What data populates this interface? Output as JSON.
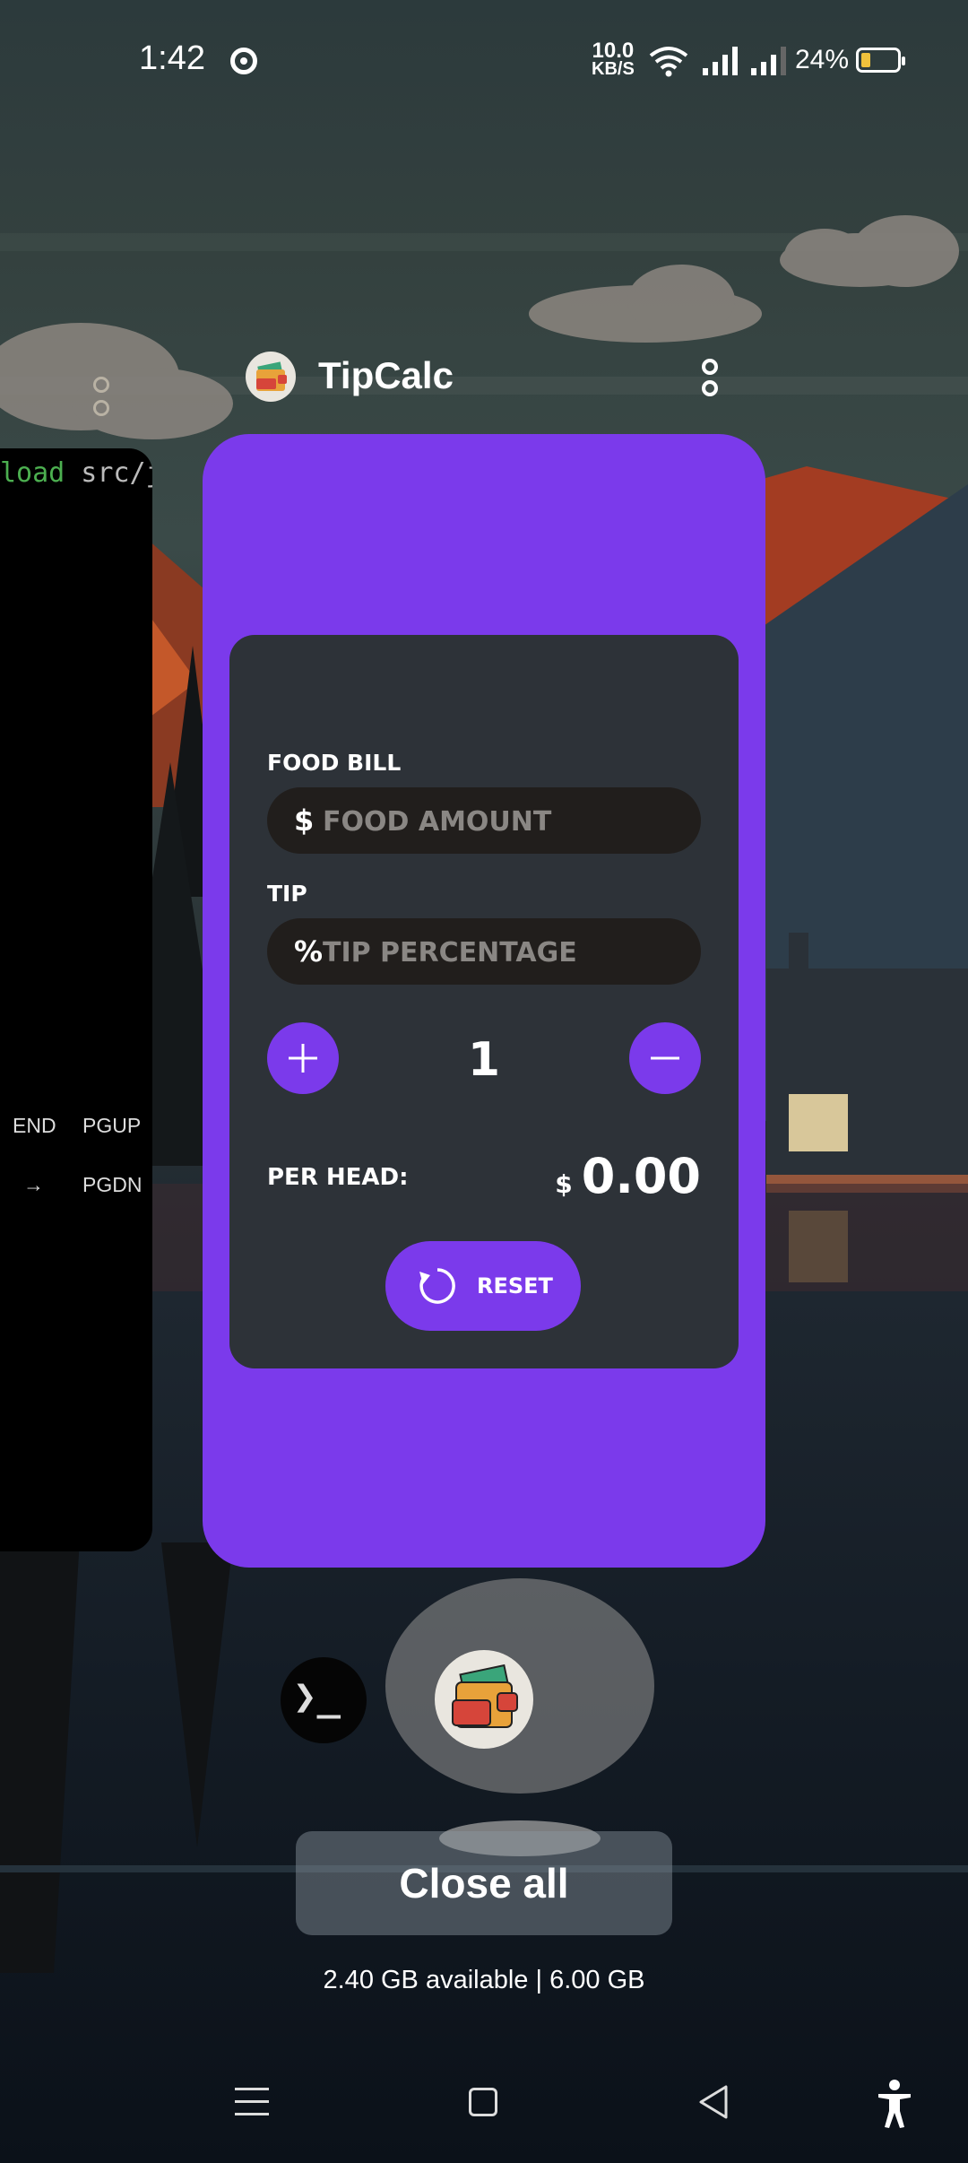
{
  "status_bar": {
    "time": "1:42",
    "net_speed_value": "10.0",
    "net_speed_unit": "KB/S",
    "battery_percent": "24%"
  },
  "background_app": {
    "code_text_green": "load",
    "code_text": " src/j",
    "keys": [
      "END",
      "PGUP",
      "→",
      "PGDN"
    ]
  },
  "app_header": {
    "title": "TipCalc"
  },
  "tipcalc": {
    "food_bill_label": "FOOD BILL",
    "food_currency_symbol": "$",
    "food_placeholder": "FOOD AMOUNT",
    "tip_label": "TIP",
    "tip_symbol": "%",
    "tip_placeholder": "TIP PERCENTAGE",
    "people_count": "1",
    "per_head_label": "PER HEAD:",
    "per_head_currency": "$",
    "per_head_value": "0.00",
    "reset_label": "RESET"
  },
  "recents": {
    "terminal_icon": "❯_",
    "close_all_label": "Close all",
    "memory_text": "2.40 GB available | 6.00 GB"
  },
  "colors": {
    "accent": "#7b3aeb",
    "panel": "#2d3238",
    "field": "#211e1c"
  },
  "icons": [
    "chrome-icon",
    "wifi-icon",
    "signal-icon",
    "battery-icon",
    "wallet-icon",
    "more-vert-icon",
    "plus-icon",
    "minus-icon",
    "reset-icon",
    "terminal-icon",
    "menu-icon",
    "home-icon",
    "back-icon",
    "accessibility-icon"
  ]
}
